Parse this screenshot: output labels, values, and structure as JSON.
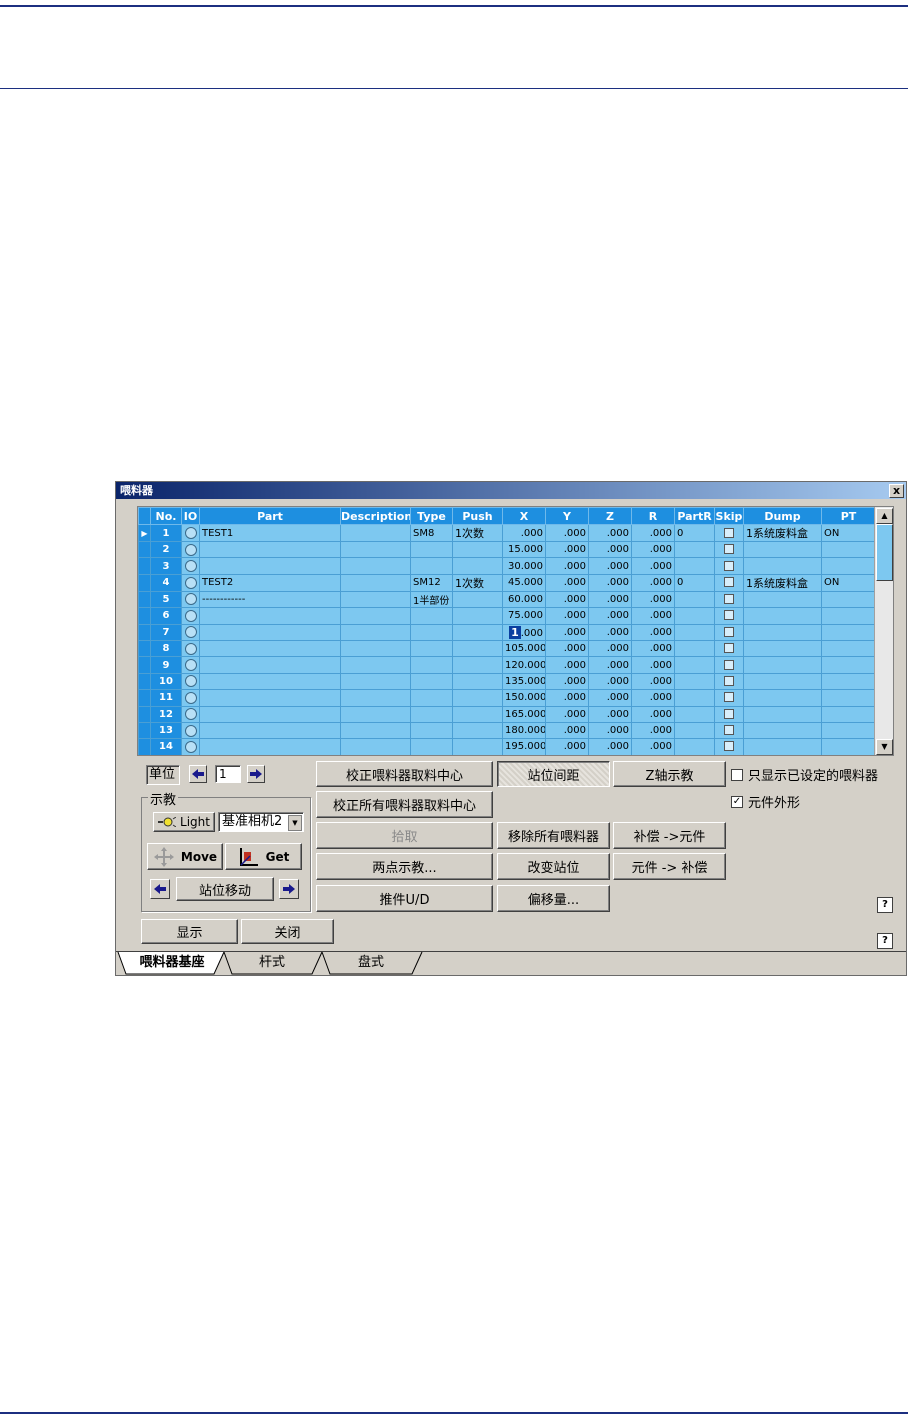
{
  "window": {
    "title": "喂料器",
    "close_label": "x"
  },
  "table": {
    "columns": [
      "No.",
      "IO",
      "Part",
      "Description",
      "Type",
      "Push",
      "X",
      "Y",
      "Z",
      "R",
      "PartR",
      "Skip",
      "Dump",
      "PT"
    ],
    "rows": [
      {
        "no": "1",
        "part": "TEST1",
        "desc": "",
        "type": "SM8",
        "push": "1次数",
        "x": ".000",
        "y": ".000",
        "z": ".000",
        "r": ".000",
        "partr": "0",
        "dump": "1系统废料盒",
        "pt": "ON"
      },
      {
        "no": "2",
        "part": "",
        "desc": "",
        "type": "",
        "push": "",
        "x": "15.000",
        "y": ".000",
        "z": ".000",
        "r": ".000",
        "partr": "",
        "dump": "",
        "pt": ""
      },
      {
        "no": "3",
        "part": "",
        "desc": "",
        "type": "",
        "push": "",
        "x": "30.000",
        "y": ".000",
        "z": ".000",
        "r": ".000",
        "partr": "",
        "dump": "",
        "pt": ""
      },
      {
        "no": "4",
        "part": "TEST2",
        "desc": "",
        "type": "SM12",
        "push": "1次数",
        "x": "45.000",
        "y": ".000",
        "z": ".000",
        "r": ".000",
        "partr": "0",
        "dump": "1系统废料盒",
        "pt": "ON"
      },
      {
        "no": "5",
        "part": "------------",
        "desc": "",
        "type": "1半部份",
        "push": "",
        "x": "60.000",
        "y": ".000",
        "z": ".000",
        "r": ".000",
        "partr": "",
        "dump": "",
        "pt": ""
      },
      {
        "no": "6",
        "part": "",
        "desc": "",
        "type": "",
        "push": "",
        "x": "75.000",
        "y": ".000",
        "z": ".000",
        "r": ".000",
        "partr": "",
        "dump": "",
        "pt": ""
      },
      {
        "no": "7",
        "part": "",
        "desc": "",
        "type": "",
        "push": "",
        "x": "1",
        "x_rest": ".000",
        "y": ".000",
        "z": ".000",
        "r": ".000",
        "partr": "",
        "dump": "",
        "pt": ""
      },
      {
        "no": "8",
        "part": "",
        "desc": "",
        "type": "",
        "push": "",
        "x": "105.000",
        "y": ".000",
        "z": ".000",
        "r": ".000",
        "partr": "",
        "dump": "",
        "pt": ""
      },
      {
        "no": "9",
        "part": "",
        "desc": "",
        "type": "",
        "push": "",
        "x": "120.000",
        "y": ".000",
        "z": ".000",
        "r": ".000",
        "partr": "",
        "dump": "",
        "pt": ""
      },
      {
        "no": "10",
        "part": "",
        "desc": "",
        "type": "",
        "push": "",
        "x": "135.000",
        "y": ".000",
        "z": ".000",
        "r": ".000",
        "partr": "",
        "dump": "",
        "pt": ""
      },
      {
        "no": "11",
        "part": "",
        "desc": "",
        "type": "",
        "push": "",
        "x": "150.000",
        "y": ".000",
        "z": ".000",
        "r": ".000",
        "partr": "",
        "dump": "",
        "pt": ""
      },
      {
        "no": "12",
        "part": "",
        "desc": "",
        "type": "",
        "push": "",
        "x": "165.000",
        "y": ".000",
        "z": ".000",
        "r": ".000",
        "partr": "",
        "dump": "",
        "pt": ""
      },
      {
        "no": "13",
        "part": "",
        "desc": "",
        "type": "",
        "push": "",
        "x": "180.000",
        "y": ".000",
        "z": ".000",
        "r": ".000",
        "partr": "",
        "dump": "",
        "pt": ""
      },
      {
        "no": "14",
        "part": "",
        "desc": "",
        "type": "",
        "push": "",
        "x": "195.000",
        "y": ".000",
        "z": ".000",
        "r": ".000",
        "partr": "",
        "dump": "",
        "pt": ""
      }
    ]
  },
  "controls": {
    "unit_label": "单位",
    "unit_value": "1",
    "teach_group": "示教",
    "light_label": "Light",
    "camera_select": "基准相机2",
    "move_label": "Move",
    "get_label": "Get",
    "station_move": "站位移动",
    "calibrate_center": "校正喂料器取料中心",
    "calibrate_all": "校正所有喂料器取料中心",
    "pick": "拾取",
    "two_point_teach": "两点示教...",
    "pusher_ud": "推件U/D",
    "station_pitch": "站位间距",
    "remove_all": "移除所有喂料器",
    "change_station": "改变站位",
    "offset": "偏移量...",
    "z_teach": "Z轴示教",
    "comp_to_part": "补偿 ->元件",
    "part_to_comp": "元件 -> 补偿",
    "only_show_set": "只显示已设定的喂料器",
    "part_shape": "元件外形",
    "display": "显示",
    "close": "关闭",
    "help": "?"
  },
  "tabs": [
    "喂料器基座",
    "杆式",
    "盘式"
  ]
}
